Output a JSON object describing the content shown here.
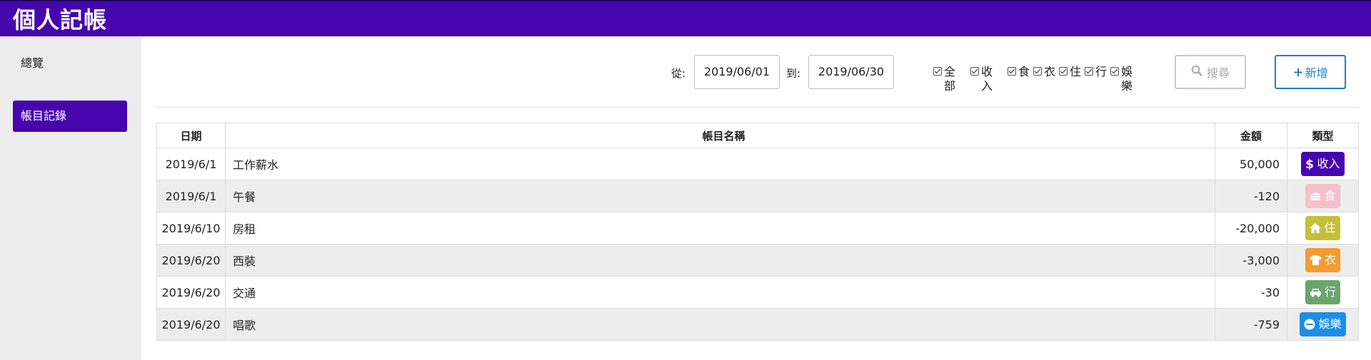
{
  "app": {
    "title": "個人記帳"
  },
  "sidebar": {
    "items": [
      {
        "label": "總覽"
      },
      {
        "label": "帳目記錄"
      }
    ]
  },
  "filter": {
    "from_label": "從:",
    "from_value": "2019/06/01",
    "to_label": "到:",
    "to_value": "2019/06/30",
    "categories": [
      {
        "label": "全部",
        "checked": true
      },
      {
        "label": "收入",
        "checked": true
      },
      {
        "label": "食",
        "checked": true
      },
      {
        "label": "衣",
        "checked": true
      },
      {
        "label": "住",
        "checked": true
      },
      {
        "label": "行",
        "checked": true
      },
      {
        "label": "娛樂",
        "checked": true
      }
    ],
    "search_label": "搜尋",
    "search_icon": "search-icon",
    "add_label": "新增",
    "add_icon": "plus-icon"
  },
  "table": {
    "headers": {
      "date": "日期",
      "name": "帳目名稱",
      "amount": "金額",
      "type": "類型"
    },
    "rows": [
      {
        "date": "2019/6/1",
        "name": "工作薪水",
        "amount": "50,000",
        "type": "收入",
        "icon": "dollar-icon",
        "color": "#4705ad"
      },
      {
        "date": "2019/6/1",
        "name": "午餐",
        "amount": "-120",
        "type": "食",
        "icon": "burger-icon",
        "color": "#f5bfcb"
      },
      {
        "date": "2019/6/10",
        "name": "房租",
        "amount": "-20,000",
        "type": "住",
        "icon": "home-icon",
        "color": "#c3c13a"
      },
      {
        "date": "2019/6/20",
        "name": "西裝",
        "amount": "-3,000",
        "type": "衣",
        "icon": "shirt-icon",
        "color": "#f49c2e"
      },
      {
        "date": "2019/6/20",
        "name": "交通",
        "amount": "-30",
        "type": "行",
        "icon": "car-icon",
        "color": "#6aa56e"
      },
      {
        "date": "2019/6/20",
        "name": "唱歌",
        "amount": "-759",
        "type": "娛樂",
        "icon": "smile-icon",
        "color": "#1c8ee6"
      }
    ]
  }
}
